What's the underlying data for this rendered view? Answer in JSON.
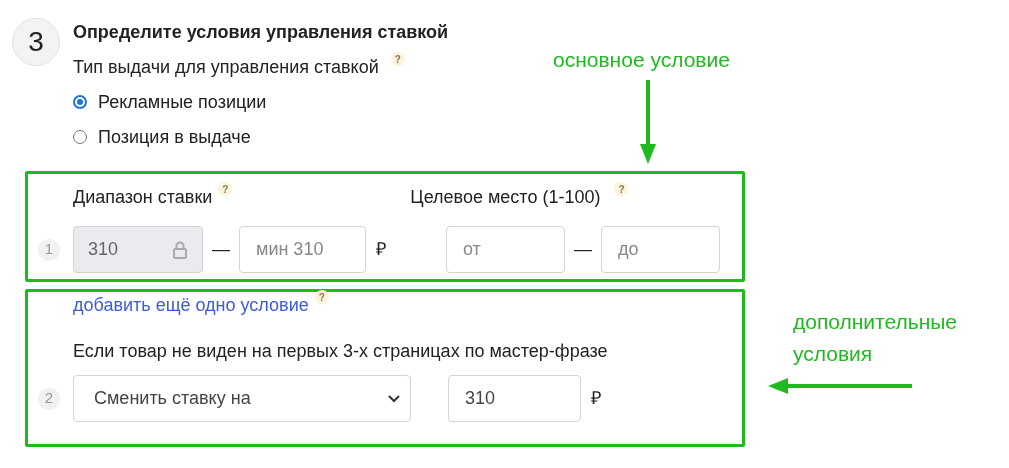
{
  "step": {
    "number": "3",
    "title": "Определите условия управления ставкой"
  },
  "issue_type": {
    "label": "Тип выдачи для управления ставкой",
    "help": "?",
    "options": [
      {
        "label": "Рекламные позиции",
        "selected": true
      },
      {
        "label": "Позиция в выдаче",
        "selected": false
      }
    ]
  },
  "conditions": [
    {
      "kind": "range",
      "number": "1",
      "bid_range": {
        "label": "Диапазон ставки",
        "help": "?",
        "locked_value": "310",
        "max_placeholder": "мин 310",
        "separator": "—",
        "currency": "₽"
      },
      "target_place": {
        "label": "Целевое место (1-100)",
        "help": "?",
        "from_placeholder": "от",
        "separator": "—",
        "to_placeholder": "до"
      }
    },
    {
      "kind": "rule",
      "number": "2",
      "add_link": "добавить ещё одно условие",
      "help": "?",
      "condition_text": "Если товар не виден на первых 3-х страницах по мастер-фразе",
      "action": "Сменить ставку на",
      "value": "310",
      "currency": "₽"
    }
  ],
  "annotations": [
    {
      "kind": "main",
      "text": "основное условие"
    },
    {
      "kind": "extra",
      "text": "дополнительные условия"
    }
  ]
}
